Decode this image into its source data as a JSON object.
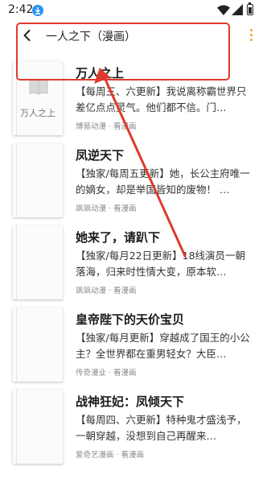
{
  "status_bar": {
    "time": "2:42"
  },
  "header": {
    "title": "一人之下（漫画）"
  },
  "books": [
    {
      "title": "万人之上",
      "desc": "【每周三、六更新】我说离称霸世界只差亿点点灵气。他们都不信。门…",
      "meta": "博易动漫 · 看漫画",
      "cover_text": "万人之上"
    },
    {
      "title": "凤逆天下",
      "desc": "【独家/每周五更新】她，长公主府唯一的嫡女，却是举国皆知的废物！ …",
      "meta": "飒飒动漫 · 看漫画",
      "cover_text": ""
    },
    {
      "title": "她来了，请趴下",
      "desc": "【独家/每月22日更新】18线演员一朝落海，归来时性情大变，原本软…",
      "meta": "飒飒动漫 · 看漫画",
      "cover_text": ""
    },
    {
      "title": "皇帝陛下的天价宝贝",
      "desc": "【独家/每月更新】穿越成了国王的小公主？全世界都在重男轻女？大臣…",
      "meta": "传奇漫业 · 看漫画",
      "cover_text": ""
    },
    {
      "title": "战神狂妃：凤倾天下",
      "desc": "【每周四、六更新】特种鬼才盛浅予，一朝穿越，没想到自己再醒来…",
      "meta": "爱奇艺漫画 · 看漫画",
      "cover_text": ""
    }
  ],
  "colors": {
    "accent_menu": "#f3a02a",
    "annotation": "#e03a2e",
    "download_badge": "#2a93f0"
  }
}
